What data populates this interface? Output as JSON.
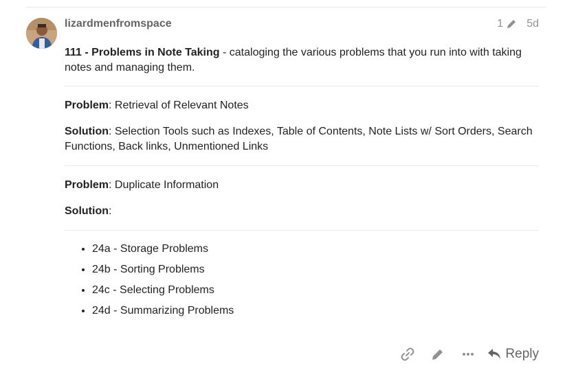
{
  "post": {
    "username": "lizardmenfromspace",
    "edit_count": "1",
    "age": "5d",
    "intro_title": "111 - Problems in Note Taking",
    "intro_text": " - cataloging the various problems that you run into with taking notes and managing them.",
    "sections": [
      {
        "problem_label": "Problem",
        "problem_text": ": Retrieval of Relevant Notes",
        "solution_label": "Solution",
        "solution_text": ": Selection Tools such as Indexes, Table of Contents, Note Lists w/ Sort Orders, Search Functions, Back links, Unmentioned Links"
      },
      {
        "problem_label": "Problem",
        "problem_text": ": Duplicate Information",
        "solution_label": "Solution",
        "solution_text": ":"
      }
    ],
    "related": [
      "24a - Storage Problems",
      "24b - Sorting Problems",
      "24c - Selecting Problems",
      "24d - Summarizing Problems"
    ]
  },
  "actions": {
    "reply_label": "Reply",
    "icons": [
      "link-icon",
      "pencil-icon",
      "ellipsis-icon",
      "reply-icon"
    ]
  },
  "colors": {
    "muted": "#919191",
    "username": "#646464",
    "divider": "#e9e9e9"
  }
}
